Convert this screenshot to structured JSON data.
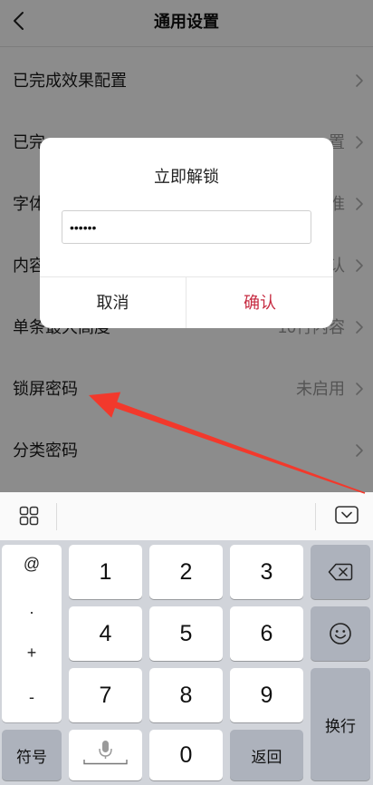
{
  "header": {
    "title": "通用设置"
  },
  "settings": {
    "rows": [
      {
        "label": "已完成效果配置"
      },
      {
        "label": "已完",
        "value": "置"
      },
      {
        "label": "字体",
        "value": "准"
      },
      {
        "label": "内容",
        "value": "认"
      },
      {
        "label": "单条最大高度",
        "value": "10行内容"
      },
      {
        "label": "锁屏密码",
        "value": "未启用"
      },
      {
        "label": "分类密码"
      }
    ]
  },
  "dialog": {
    "title": "立即解锁",
    "password_value": "••••••",
    "cancel_label": "取消",
    "confirm_label": "确认"
  },
  "keyboard": {
    "symbols": [
      "@",
      ".",
      "+",
      "-"
    ],
    "symbol_toggle_label": "符号",
    "digits": [
      "1",
      "2",
      "3",
      "4",
      "5",
      "6",
      "7",
      "8",
      "9"
    ],
    "zero": "0",
    "back_label": "返回",
    "enter_label": "换行"
  },
  "icons": {
    "back": "chevron-left-icon",
    "row_chevron": "chevron-right-icon",
    "toolbar_left": "grid-icon",
    "toolbar_right": "keyboard-collapse-icon",
    "backspace": "backspace-icon",
    "emoji": "smiley-icon",
    "voice": "microphone-icon",
    "annotation": "red-arrow-icon"
  },
  "colors": {
    "confirm_text": "#c62a40",
    "annotation_arrow": "#f2392c",
    "overlay": "rgba(0,0,0,0.45)",
    "keyboard_background": "#d1d4da",
    "function_key": "#adb2bc"
  }
}
